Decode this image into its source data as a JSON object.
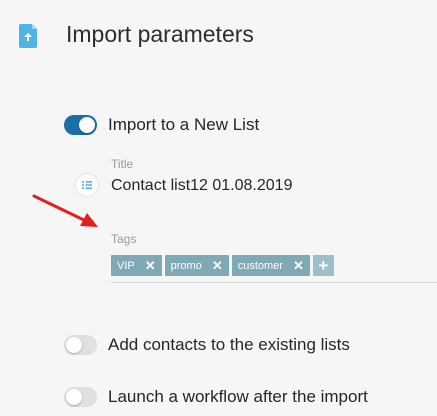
{
  "header": {
    "title": "Import parameters",
    "icon": "upload-file-icon"
  },
  "options": {
    "new_list": {
      "label": "Import to a New List",
      "enabled": true
    },
    "existing_lists": {
      "label": "Add contacts to the existing lists",
      "enabled": false
    },
    "workflow": {
      "label": "Launch a workflow after the import",
      "enabled": false
    }
  },
  "title_field": {
    "label": "Title",
    "value": "Contact list12 01.08.2019",
    "icon": "list-icon"
  },
  "tags_field": {
    "label": "Tags",
    "tags": [
      {
        "label": "VIP",
        "remove": "✕"
      },
      {
        "label": "promo",
        "remove": "✕"
      },
      {
        "label": "customer",
        "remove": "✕"
      }
    ],
    "add_label": "+"
  },
  "colors": {
    "accent": "#1a6fa6",
    "tag": "#7ea9b5",
    "annotation_arrow": "#e02020"
  }
}
